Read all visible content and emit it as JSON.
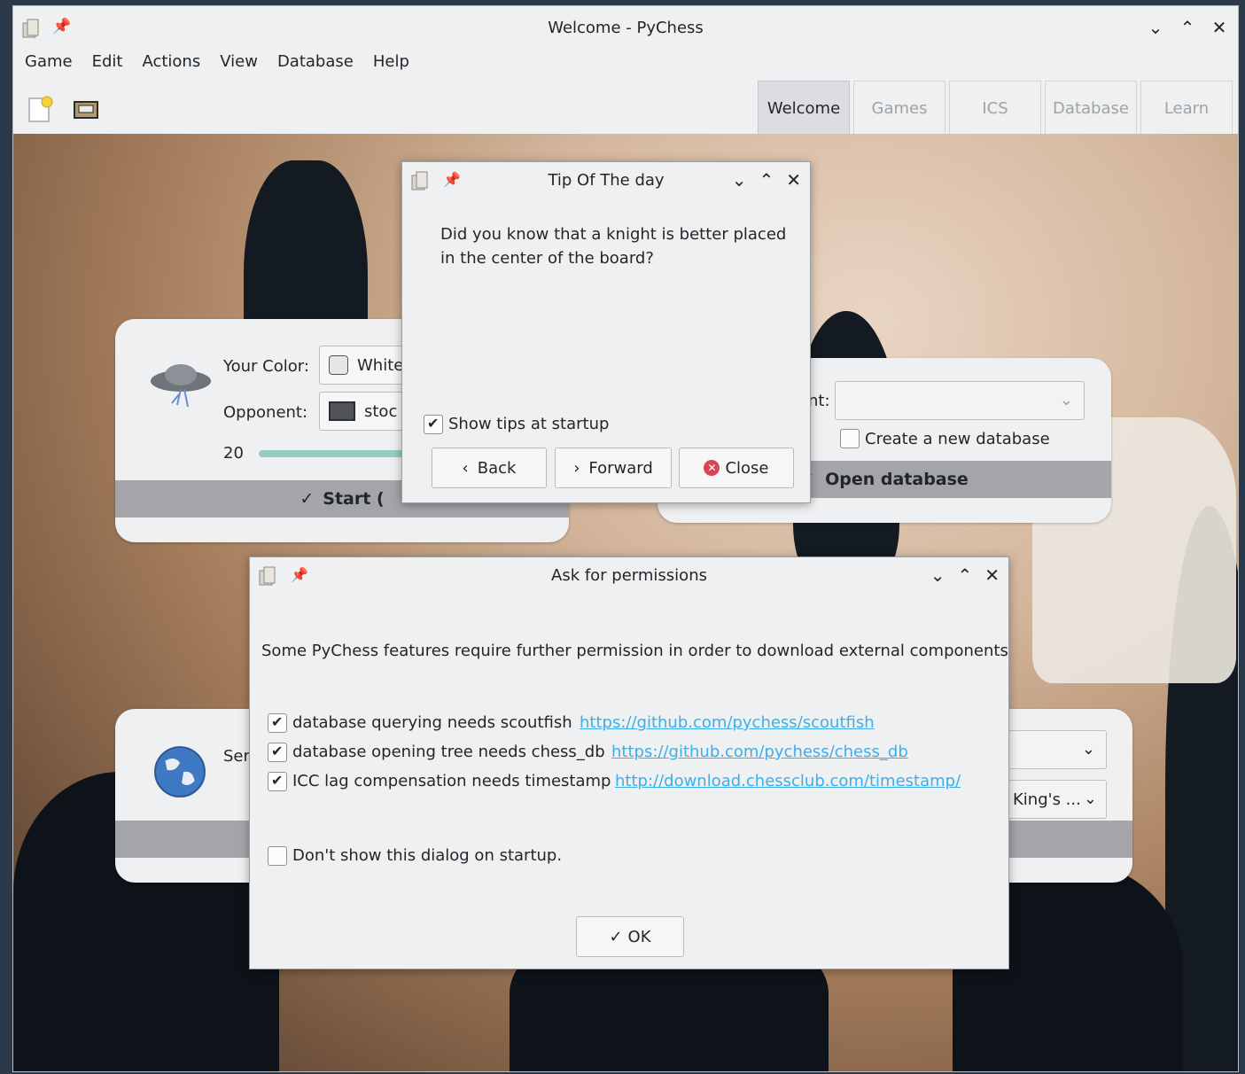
{
  "window": {
    "title": "Welcome - PyChess",
    "controls": [
      "⌄",
      "⌃",
      "✕"
    ]
  },
  "menu": [
    "Game",
    "Edit",
    "Actions",
    "View",
    "Database",
    "Help"
  ],
  "tabs": [
    {
      "label": "Welcome",
      "active": true
    },
    {
      "label": "Games",
      "active": false
    },
    {
      "label": "ICS",
      "active": false
    },
    {
      "label": "Database",
      "active": false
    },
    {
      "label": "Learn",
      "active": false
    }
  ],
  "play_panel": {
    "your_color_label": "Your Color:",
    "your_color_value": "White",
    "opponent_label": "Opponent:",
    "opponent_value": "stoc",
    "level_value": "20",
    "start_label": "Start (",
    "start_icon": "✓"
  },
  "database_panel": {
    "partial_label": "nt:",
    "create_label": "Create a new database",
    "open_label": "Open database",
    "open_icon": "✓"
  },
  "server_panel": {
    "partial_label": "Ser",
    "variant_value": "King's ..."
  },
  "tip_dialog": {
    "title": "Tip Of The day",
    "text": "Did you know that a knight is better placed in the center of the board?",
    "show_tips_label": "Show tips at startup",
    "back_label": "Back",
    "forward_label": "Forward",
    "close_label": "Close"
  },
  "perm_dialog": {
    "title": "Ask for permissions",
    "intro": "Some PyChess features require further permission in order to download external components",
    "items": [
      {
        "label": "database querying needs scoutfish",
        "link": "https://github.com/pychess/scoutfish",
        "checked": true
      },
      {
        "label": "database opening tree needs chess_db",
        "link": "https://github.com/pychess/chess_db",
        "checked": true
      },
      {
        "label": "ICC lag compensation needs timestamp",
        "link": "http://download.chessclub.com/timestamp/",
        "checked": true
      }
    ],
    "dont_show_label": "Don't show this dialog on startup.",
    "ok_label": "OK"
  },
  "colors": {
    "accent": "#3daee9",
    "window_bg": "#eff0f1",
    "bar_gray": "#a3a5a8",
    "slider": "#93cec0"
  }
}
